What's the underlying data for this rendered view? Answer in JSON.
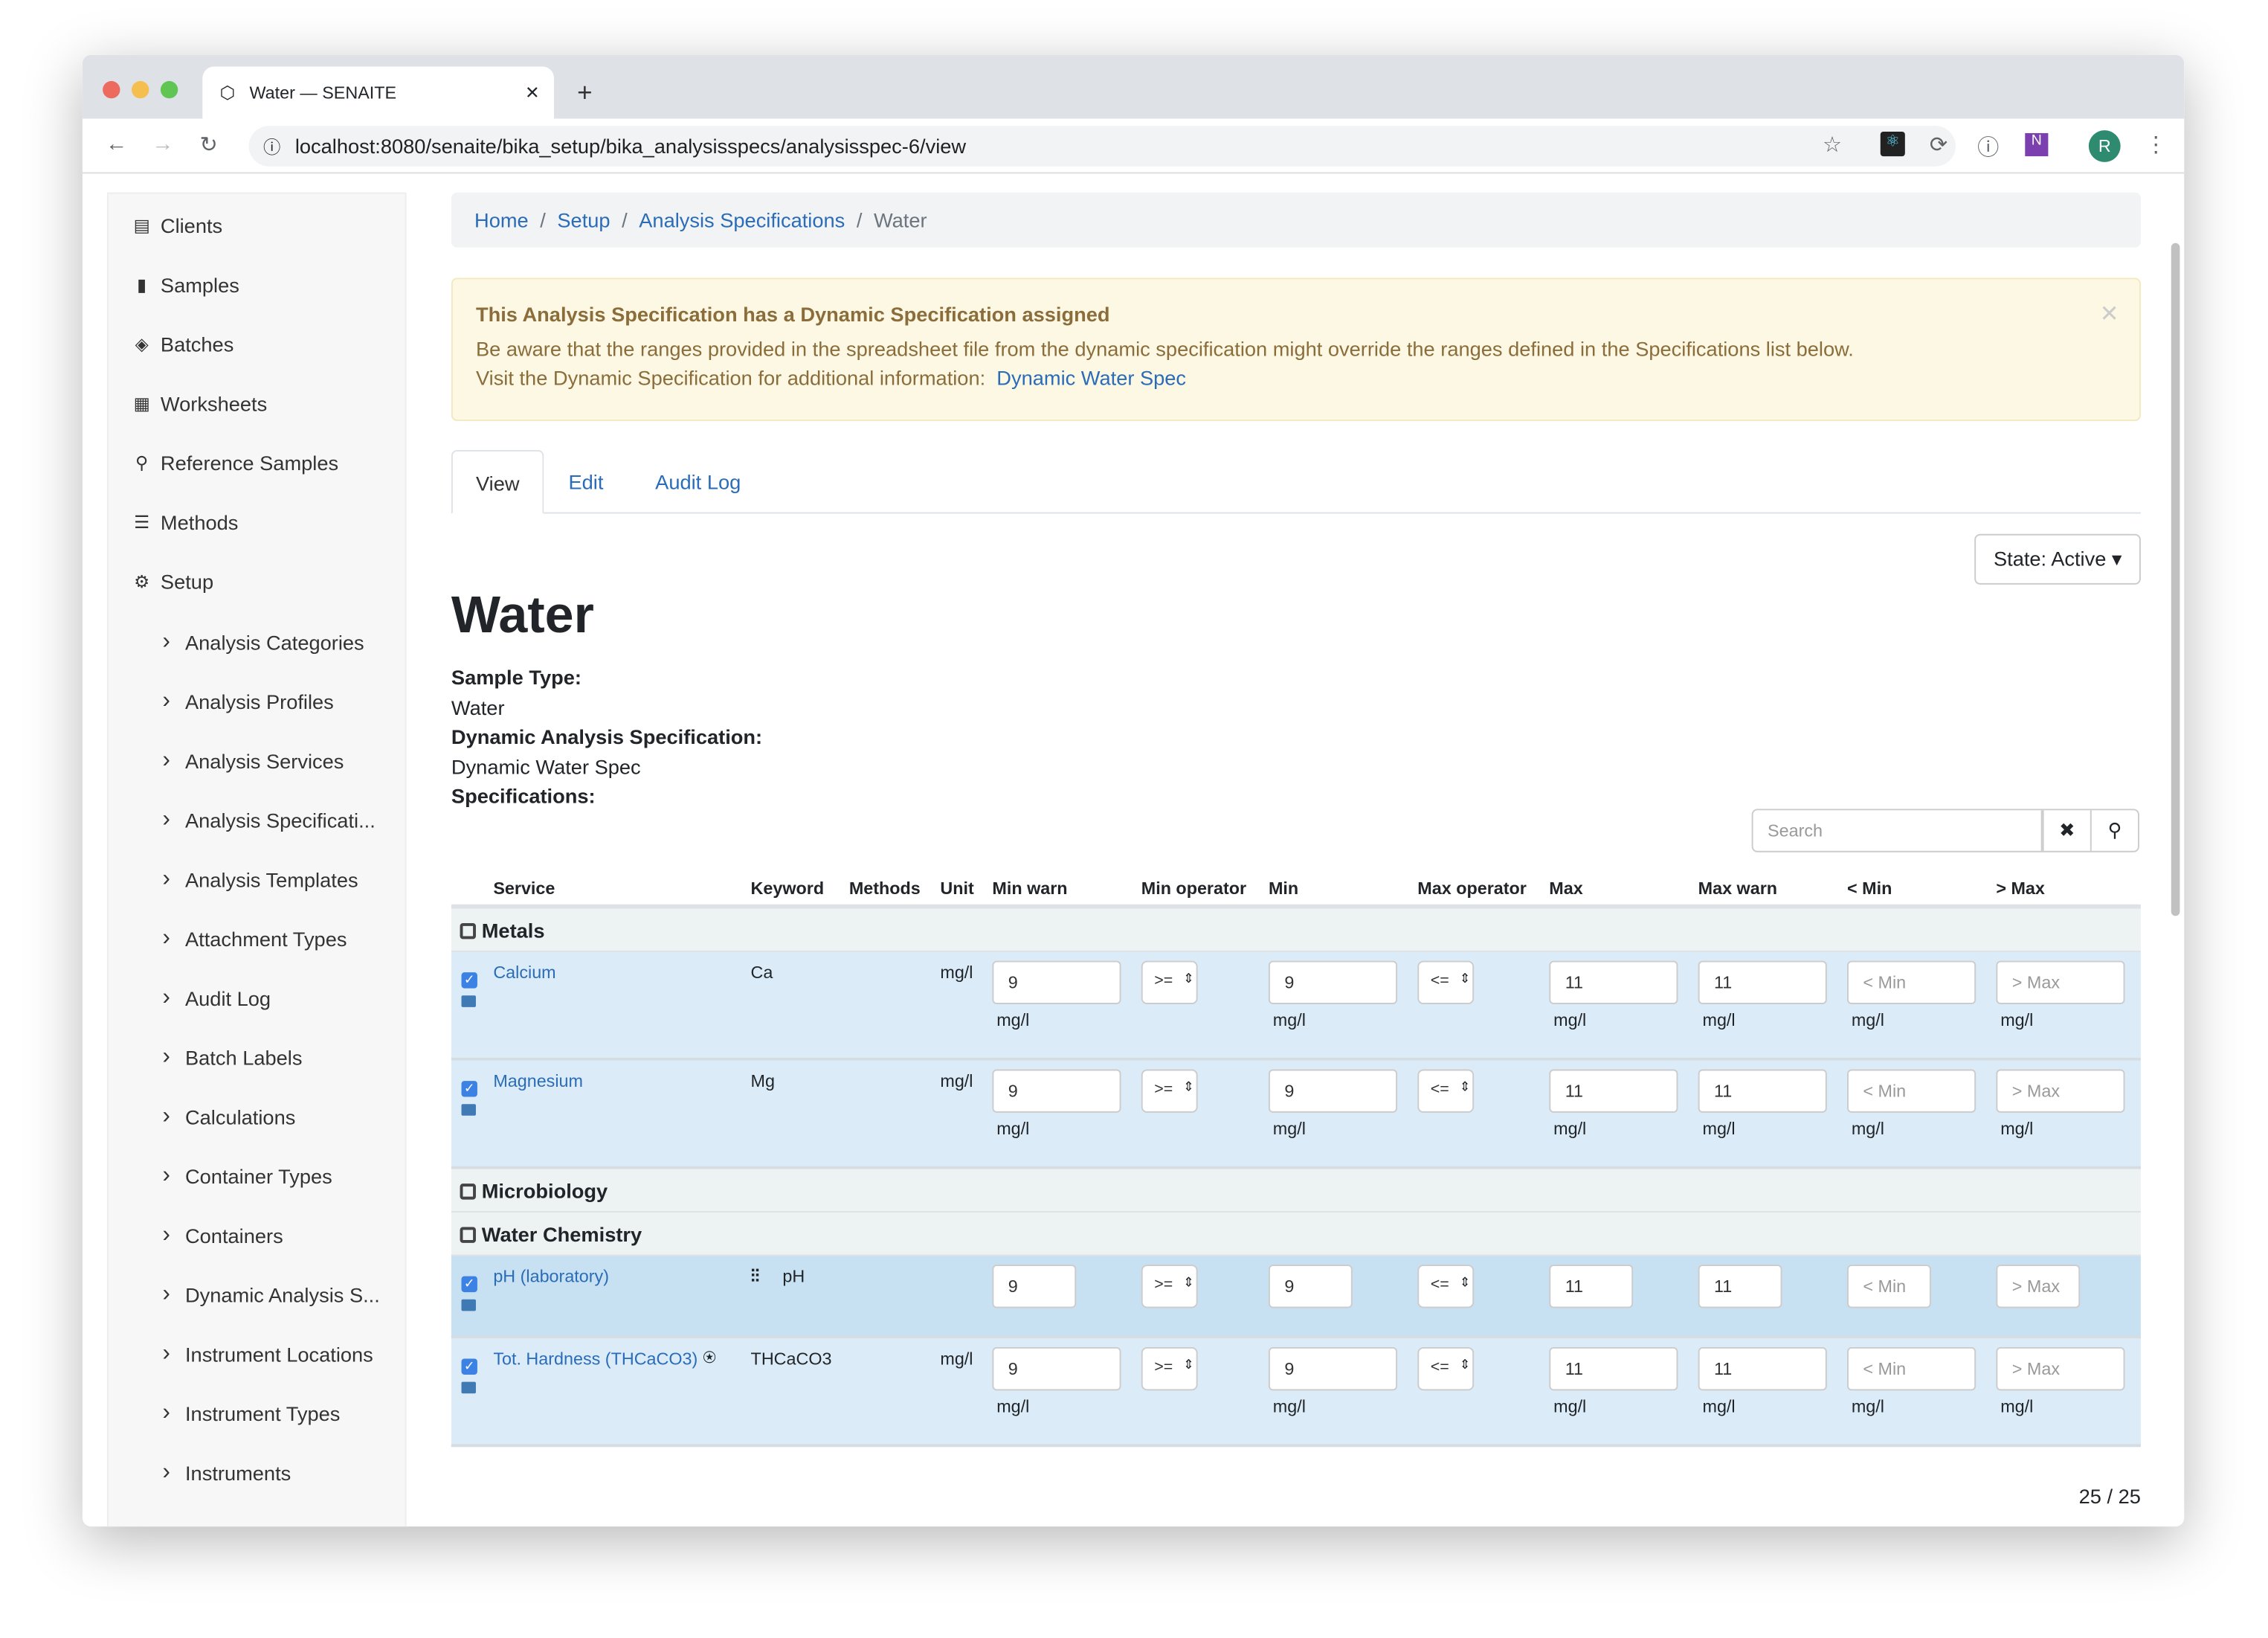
{
  "browser": {
    "tab_title": "Water — SENAITE",
    "url": "localhost:8080/senaite/bika_setup/bika_analysisspecs/analysisspec-6/view",
    "profile_initial": "R"
  },
  "sidebar": {
    "items": [
      {
        "label": "Clients",
        "icon": "id-card-icon"
      },
      {
        "label": "Samples",
        "icon": "vial-icon"
      },
      {
        "label": "Batches",
        "icon": "layers-icon"
      },
      {
        "label": "Worksheets",
        "icon": "clipboard-icon"
      },
      {
        "label": "Reference Samples",
        "icon": "reference-icon"
      },
      {
        "label": "Methods",
        "icon": "list-icon"
      },
      {
        "label": "Setup",
        "icon": "gears-icon"
      }
    ],
    "subitems": [
      "Analysis Categories",
      "Analysis Profiles",
      "Analysis Services",
      "Analysis Specificati...",
      "Analysis Templates",
      "Attachment Types",
      "Audit Log",
      "Batch Labels",
      "Calculations",
      "Container Types",
      "Containers",
      "Dynamic Analysis S...",
      "Instrument Locations",
      "Instrument Types",
      "Instruments"
    ]
  },
  "breadcrumb": [
    "Home",
    "Setup",
    "Analysis Specifications",
    "Water"
  ],
  "alert": {
    "title": "This Analysis Specification has a Dynamic Specification assigned",
    "line1": "Be aware that the ranges provided in the spreadsheet file from the dynamic specification might override the ranges defined in the Specifications list below.",
    "line2": "Visit the Dynamic Specification for additional information:",
    "link": "Dynamic Water Spec"
  },
  "tabs": [
    "View",
    "Edit",
    "Audit Log"
  ],
  "state_button": "State: Active ▾",
  "title": "Water",
  "fields": {
    "sample_type_label": "Sample Type:",
    "sample_type": "Water",
    "dynamic_label": "Dynamic Analysis Specification:",
    "dynamic": "Dynamic Water Spec",
    "specs_label": "Specifications:"
  },
  "search": {
    "placeholder": "Search"
  },
  "columns": [
    "Service",
    "Keyword",
    "Methods",
    "Unit",
    "Min warn",
    "Min operator",
    "Min",
    "Max operator",
    "Max",
    "Max warn",
    "< Min",
    "> Max"
  ],
  "groups": [
    {
      "name": "Metals",
      "rows": [
        {
          "service": "Calcium",
          "keyword": "Ca",
          "unit": "mg/l",
          "min_warn": "9",
          "min_op": ">=",
          "min": "9",
          "max_op": "<=",
          "max": "11",
          "max_warn": "11",
          "hidemin": "",
          "hidemax": "",
          "checked": true
        },
        {
          "service": "Magnesium",
          "keyword": "Mg",
          "unit": "mg/l",
          "min_warn": "9",
          "min_op": ">=",
          "min": "9",
          "max_op": "<=",
          "max": "11",
          "max_warn": "11",
          "hidemin": "",
          "hidemax": "",
          "checked": true
        }
      ]
    },
    {
      "name": "Microbiology",
      "rows": []
    },
    {
      "name": "Water Chemistry",
      "rows": [
        {
          "service": "pH (laboratory)",
          "keyword": "pH",
          "unit": "",
          "min_warn": "9",
          "min_op": ">=",
          "min": "9",
          "max_op": "<=",
          "max": "11",
          "max_warn": "11",
          "hidemin": "",
          "hidemax": "",
          "checked": true,
          "selected": true,
          "short": true
        },
        {
          "service": "Tot. Hardness (THCaCO3)",
          "keyword": "THCaCO3",
          "unit": "mg/l",
          "min_warn": "9",
          "min_op": ">=",
          "min": "9",
          "max_op": "<=",
          "max": "11",
          "max_warn": "11",
          "hidemin": "",
          "hidemax": "",
          "checked": true,
          "badge": true
        }
      ]
    }
  ],
  "placeholders": {
    "hidemin": "< Min",
    "hidemax": "> Max"
  },
  "count": "25 / 25"
}
